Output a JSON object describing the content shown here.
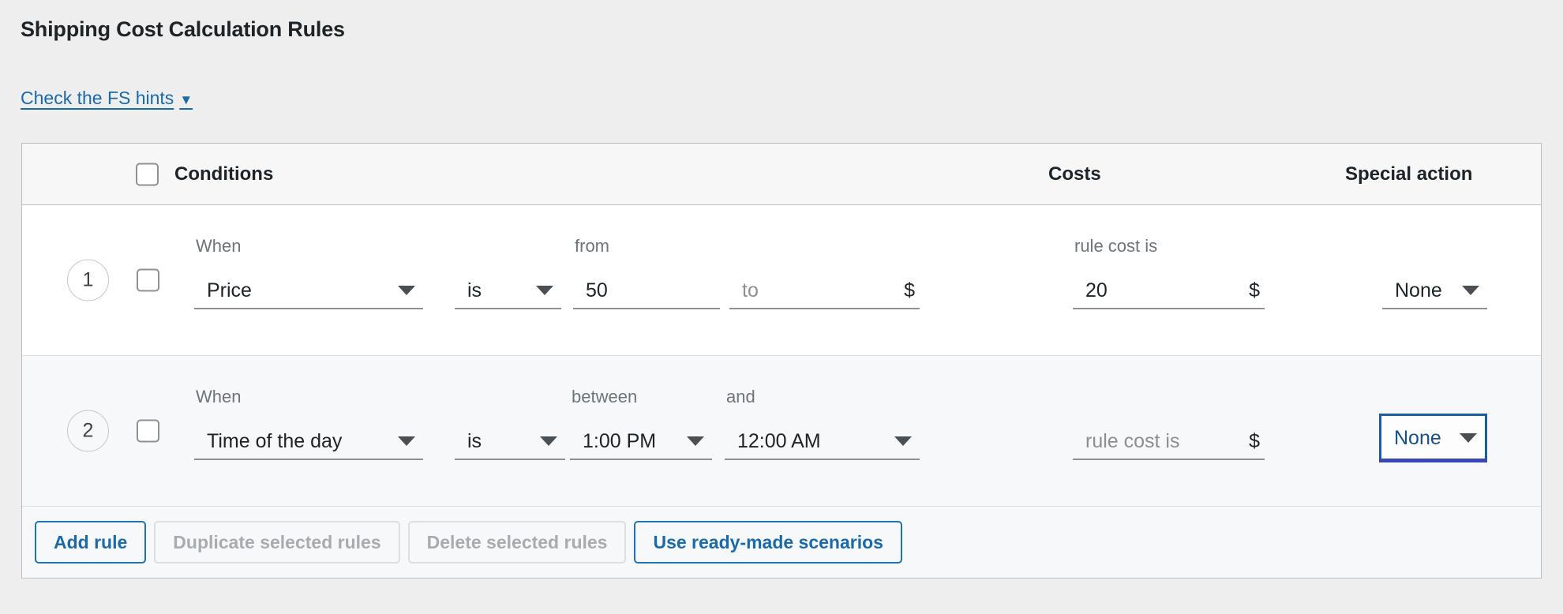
{
  "page": {
    "title": "Shipping Cost Calculation Rules",
    "hints_link": "Check the FS hints",
    "caret_glyph": "▼"
  },
  "colors": {
    "accent": "#2271b1",
    "link": "#1a6aab",
    "focus_border": "#1b5e9e",
    "text": "#1d2327",
    "muted": "#6e7478",
    "disabled": "#a7acb1",
    "page_bg": "#eeeeee",
    "row_alt_bg": "#f7f8f9",
    "border": "#b9bec4"
  },
  "table": {
    "headers": {
      "conditions": "Conditions",
      "costs": "Costs",
      "special_action": "Special action"
    },
    "select_all_checkbox": {
      "checked": false
    }
  },
  "rules": [
    {
      "index": "1",
      "checked": false,
      "when_label": "When",
      "when_value": "Price",
      "operator_value": "is",
      "range_start_label": "from",
      "range_start_value": "50",
      "range_end_label": "to",
      "range_end_value": "",
      "range_unit": "$",
      "cost_label": "rule cost is",
      "cost_value": "20",
      "cost_unit": "$",
      "special_action_value": "None",
      "special_action_focused": false
    },
    {
      "index": "2",
      "checked": false,
      "when_label": "When",
      "when_value": "Time of the day",
      "operator_value": "is",
      "range_start_label": "between",
      "range_start_value": "1:00 PM",
      "range_end_label": "and",
      "range_end_value": "12:00 AM",
      "range_unit": "",
      "cost_label": "rule cost is",
      "cost_value": "",
      "cost_unit": "$",
      "special_action_value": "None",
      "special_action_focused": true
    }
  ],
  "footer": {
    "add_rule": "Add rule",
    "duplicate_selected": "Duplicate selected rules",
    "delete_selected": "Delete selected rules",
    "ready_made": "Use ready-made scenarios"
  }
}
